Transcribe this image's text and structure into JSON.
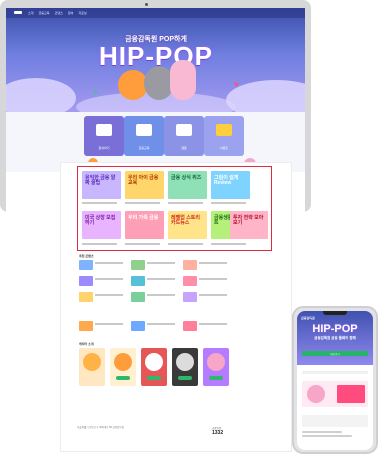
{
  "hero": {
    "subtitle": "금융감독원 POP하게",
    "title": "HIP-POP",
    "nav_items": [
      "소개",
      "금융교육",
      "콘텐츠",
      "참여",
      "자료실"
    ]
  },
  "quick_links": [
    {
      "label": "참여하기",
      "color": "#7a6fd6"
    },
    {
      "label": "금융교육",
      "color": "#6f8fe8"
    },
    {
      "label": "웹툰",
      "color": "#8a93e6"
    },
    {
      "label": "이벤트",
      "color": "#9ba2ee"
    }
  ],
  "featured": {
    "items": [
      {
        "title": "유익한 금융 알짜 꿀팁",
        "color": "#c8b6ff",
        "text_color": "#5b2bb8"
      },
      {
        "title": "우리 아이 금융교육",
        "color": "#ffd66b",
        "text_color": "#b23a00"
      },
      {
        "title": "금융 상식 퀴즈",
        "color": "#8fe0b6",
        "text_color": "#0f6a3a"
      },
      {
        "title": "그림이 쉽게 Review",
        "color": "#7fd3ff",
        "text_color": "#ffffff"
      },
      {
        "title": "미국 상장 모집하기",
        "color": "#e8b4ff",
        "text_color": "#7a1ea6"
      },
      {
        "title": "우리 가족 금융",
        "color": "#ff9fb5",
        "text_color": "#ffffff"
      },
      {
        "title": "레벨업 스토리 카드뉴스",
        "color": "#ffe48a",
        "text_color": "#d02a1c"
      },
      {
        "title": "금융생활 이벤트",
        "color": "#b5f07a",
        "text_color": "#1c6d12"
      },
      {
        "title": "투자 전략 모아보기",
        "color": "#ffb5c7",
        "text_color": "#b5122e"
      }
    ]
  },
  "sections": {
    "list_title": "추천 콘텐츠",
    "card_title": "캐릭터 소개",
    "characters": [
      {
        "color": "#ffb347"
      },
      {
        "color": "#e45756"
      },
      {
        "color": "#6c6c6c"
      },
      {
        "color": "#f7a6c8"
      },
      {
        "color": "#b57cff"
      }
    ]
  },
  "footer": {
    "text": "서울특별시 영등포구 여의대로 38 금융감독원",
    "tel_label": "금융민원",
    "tel": "1332"
  },
  "phone": {
    "logo": "금융감독원",
    "title": "HIP-POP",
    "subtitle": "금융감독원 금융 플레이 함께",
    "button": "바로가기"
  }
}
